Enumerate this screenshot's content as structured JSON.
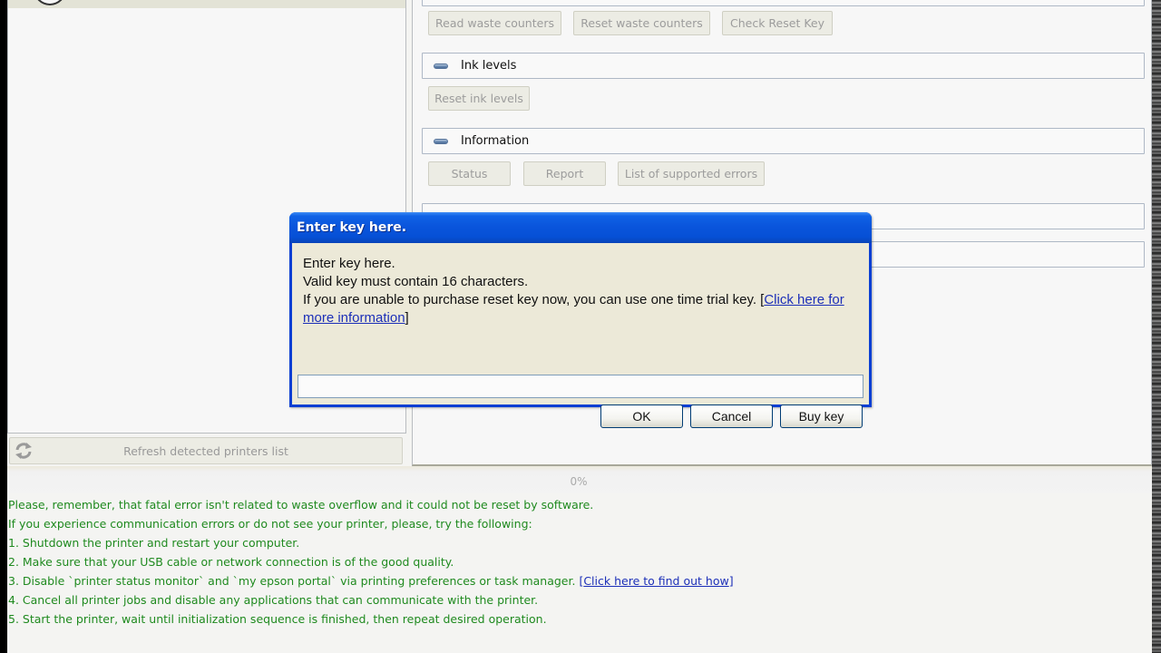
{
  "left_panel": {
    "refresh_button": "Refresh detected printers list"
  },
  "operations": {
    "waste_buttons": {
      "read": "Read waste counters",
      "reset": "Reset waste counters",
      "check_key": "Check Reset Key"
    },
    "sections": [
      {
        "title": "Ink levels",
        "buttons": [
          "Reset ink levels"
        ]
      },
      {
        "title": "Information",
        "buttons": [
          "Status",
          "Report",
          "List of supported errors"
        ]
      }
    ]
  },
  "progress": {
    "value": 0,
    "label": "0%"
  },
  "messages": {
    "lines": [
      "Please, remember, that fatal error isn't related to waste overflow and it could not be reset by software.",
      "If you experience communication errors or do not see your printer, please, try the following:",
      "1. Shutdown the printer and restart your computer.",
      "2. Make sure that your USB cable or network connection is of the good quality.",
      "3. Disable `printer status monitor` and `my epson portal` via printing preferences or task manager. ",
      "4. Cancel all printer jobs and disable any applications that can communicate with the printer.",
      "5. Start the printer, wait until initialization sequence is finished, then repeat desired operation."
    ],
    "find_out_link": "Click here to find out how",
    "text_color": "#1f8a1f",
    "link_color": "#1c2fb8"
  },
  "dialog": {
    "title": "Enter key here.",
    "line1": "Enter key here.",
    "line2": "Valid key must contain 16 characters.",
    "line3": "If you are unable to purchase reset key now, you can use one time trial key. ",
    "more_info_link": "Click here for more information",
    "input_value": "",
    "buttons": {
      "ok": "OK",
      "cancel": "Cancel",
      "buy": "Buy key"
    },
    "titlebar_color": "#0a55dc"
  }
}
